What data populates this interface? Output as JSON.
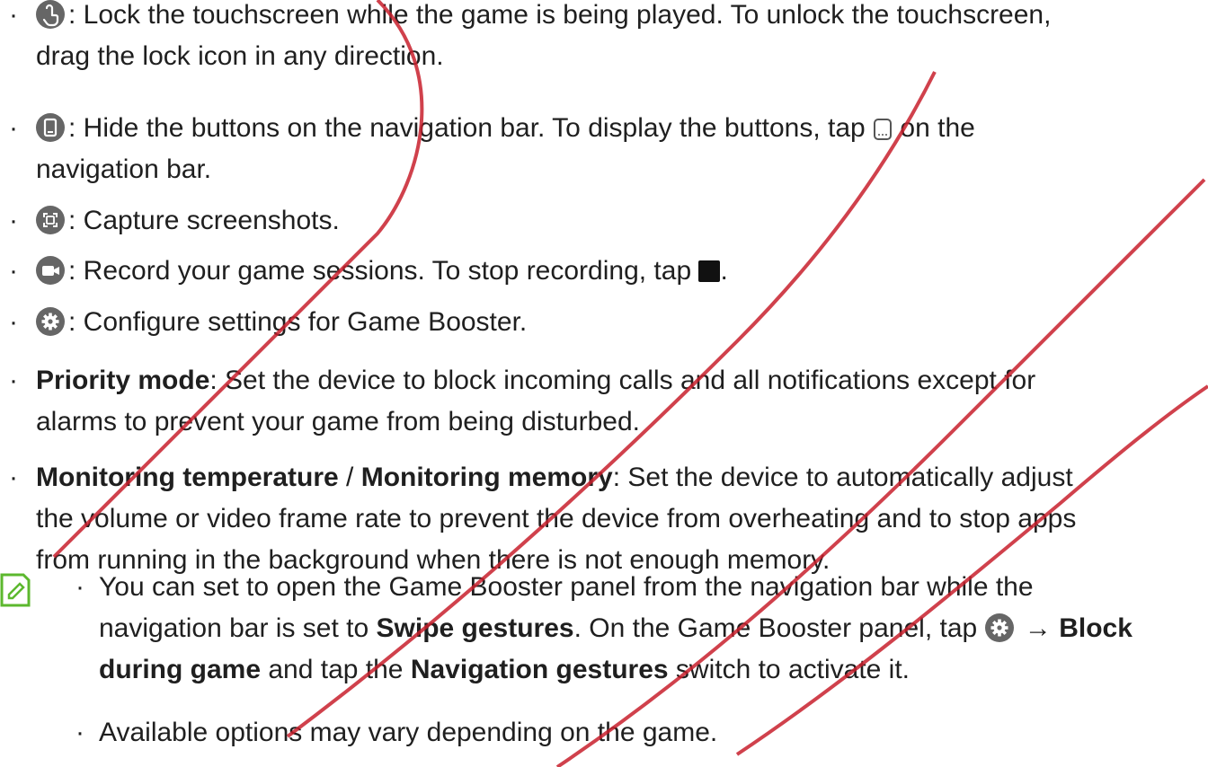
{
  "items": [
    {
      "icon": "lock-touchscreen-icon",
      "line1": ": Lock the touchscreen while the game is being played. To unlock the touchscreen,",
      "line2": "drag the lock icon in any direction."
    },
    {
      "icon": "hide-navigation-icon",
      "line1a": ": Hide the buttons on the navigation bar. To display the buttons, tap",
      "line1b": "on the",
      "line2": "navigation bar."
    },
    {
      "icon": "screenshot-icon",
      "line1": ": Capture screenshots."
    },
    {
      "icon": "record-video-icon",
      "line1a": ": Record your game sessions. To stop recording, tap",
      "line1b": "."
    },
    {
      "icon": "settings-gear-icon",
      "line1": ": Configure settings for Game Booster."
    },
    {
      "bold": "Priority mode",
      "line1": ": Set the device to block incoming calls and all notifications except for",
      "line2": "alarms to prevent your game from being disturbed."
    },
    {
      "bold1": "Monitoring temperature",
      "sep": " / ",
      "bold2": "Monitoring memory",
      "line1": ": Set the device to automatically adjust",
      "line2": "the volume or video frame rate to prevent the device from overheating and to stop apps",
      "line3": "from running in the background when there is not enough memory."
    }
  ],
  "notes": [
    {
      "line1": "You can set to open the Game Booster panel from the navigation bar while the",
      "line2a": "navigation bar is set to ",
      "line2b": "Swipe gestures",
      "line2c": ". On the Game Booster panel, tap",
      "line2d": " → ",
      "line2e": "Block",
      "line3a": "during game",
      "line3b": " and tap the ",
      "line3c": "Navigation gestures",
      "line3d": " switch to activate it."
    },
    {
      "line1": "Available options may vary depending on the game."
    }
  ],
  "bullet_char": "·",
  "colors": {
    "icon_gray": "#666666",
    "note_green": "#5cb82e",
    "watermark": "#c8202d",
    "text": "#1f1f1f"
  }
}
